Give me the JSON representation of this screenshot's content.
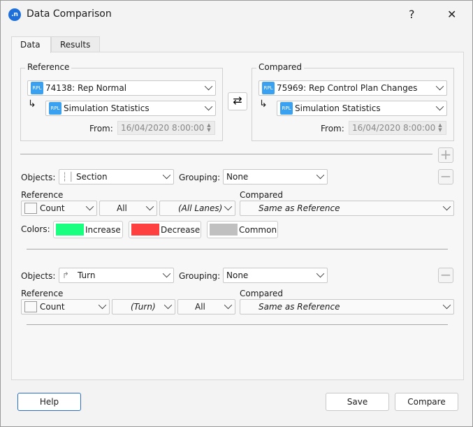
{
  "window": {
    "title": "Data Comparison",
    "help_glyph": "?",
    "close_glyph": "✕"
  },
  "tabs": [
    {
      "label": "Data"
    },
    {
      "label": "Results"
    }
  ],
  "reference": {
    "legend": "Reference",
    "source": "74138: Rep Normal",
    "sub": "Simulation Statistics",
    "from_label": "From:",
    "from_value": "16/04/2020 8:00:00",
    "badge": "RPL"
  },
  "compared": {
    "legend": "Compared",
    "source": "75969: Rep Control Plan Changes",
    "sub": "Simulation Statistics",
    "from_label": "From:",
    "from_value": "16/04/2020 8:00:00",
    "badge": "RPL"
  },
  "swap_glyph": "⇄",
  "add_glyph": "+",
  "remove_glyph": "−",
  "block1": {
    "objects_label": "Objects:",
    "objects": "Section",
    "grouping_label": "Grouping:",
    "grouping": "None",
    "reference_label": "Reference",
    "compared_label": "Compared",
    "measure": "Count",
    "filter": "All",
    "lanes": "(All Lanes)",
    "compared_value": "Same as Reference",
    "colors_label": "Colors:",
    "colors": [
      {
        "label": "Increase",
        "color": "#19ff80"
      },
      {
        "label": "Decrease",
        "color": "#ff4040"
      },
      {
        "label": "Common",
        "color": "#c0c0c0"
      }
    ]
  },
  "block2": {
    "objects_label": "Objects:",
    "objects": "Turn",
    "grouping_label": "Grouping:",
    "grouping": "None",
    "reference_label": "Reference",
    "compared_label": "Compared",
    "measure": "Count",
    "turn": "(Turn)",
    "filter": "All",
    "compared_value": "Same as Reference"
  },
  "buttons": {
    "help": "Help",
    "save": "Save",
    "compare": "Compare"
  }
}
